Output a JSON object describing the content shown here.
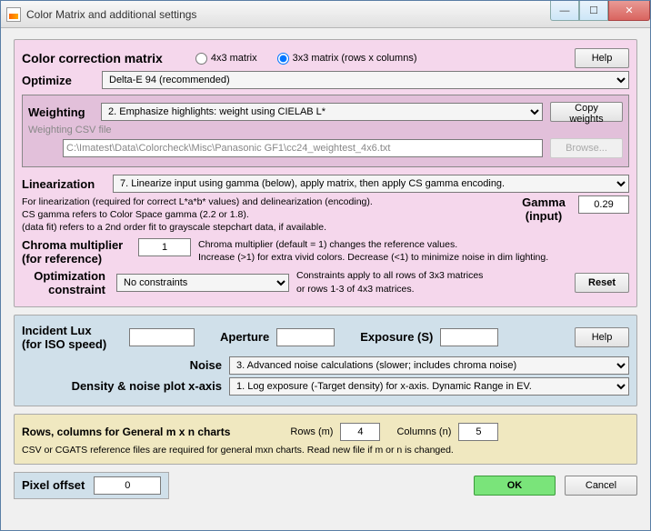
{
  "window": {
    "title": "Color Matrix and additional settings"
  },
  "ccm": {
    "header": "Color correction matrix",
    "radio4x3": "4x3 matrix",
    "radio3x3": "3x3 matrix  (rows x columns)",
    "help": "Help",
    "optimize_label": "Optimize",
    "optimize_value": "Delta-E 94  (recommended)",
    "weighting_label": "Weighting",
    "weighting_value": "2.  Emphasize highlights: weight using CIELAB L*",
    "copy_weights": "Copy weights",
    "weighting_csv_label": "Weighting CSV file",
    "weighting_csv_value": "C:\\Imatest\\Data\\Colorcheck\\Misc\\Panasonic GF1\\cc24_weightest_4x6.txt",
    "browse": "Browse...",
    "linearization_label": "Linearization",
    "linearization_value": "7.  Linearize input using gamma (below), apply matrix, then apply CS gamma encoding.",
    "lin_note1": "For linearization (required for correct L*a*b* values) and delinearization (encoding).",
    "lin_note2": "CS gamma refers to Color Space gamma (2.2 or 1.8).",
    "lin_note3": "(data fit) refers to a 2nd order fit to grayscale stepchart data, if available.",
    "gamma_label": "Gamma\n(input)",
    "gamma_value": "0.29",
    "chroma_label": "Chroma multiplier\n(for reference)",
    "chroma_value": "1",
    "chroma_note1": "Chroma multiplier (default = 1) changes the reference values.",
    "chroma_note2": "Increase  (>1) for extra vivid colors.  Decrease (<1) to minimize noise in dim lighting.",
    "optconstraint_label": "Optimization\nconstraint",
    "optconstraint_value": "No constraints",
    "optconstraint_note": "Constraints apply to all rows of 3x3 matrices\nor rows 1-3 of 4x3 matrices.",
    "reset": "Reset"
  },
  "exposure": {
    "lux_label": "Incident Lux\n(for ISO speed)",
    "aperture_label": "Aperture",
    "exposure_label": "Exposure (S)",
    "help": "Help",
    "noise_label": "Noise",
    "noise_value": "3. Advanced noise calculations (slower; includes chroma noise)",
    "density_label": "Density & noise plot x-axis",
    "density_value": "1. Log exposure (-Target density) for x-axis.     Dynamic Range in EV."
  },
  "general": {
    "title": "Rows, columns for General m x n charts",
    "rows_label": "Rows (m)",
    "rows_value": "4",
    "cols_label": "Columns (n)",
    "cols_value": "5",
    "note": "CSV or CGATS reference files are required for general mxn charts.  Read new file if m or n is changed."
  },
  "footer": {
    "pixel_offset_label": "Pixel offset",
    "pixel_offset_value": "0",
    "ok": "OK",
    "cancel": "Cancel"
  }
}
